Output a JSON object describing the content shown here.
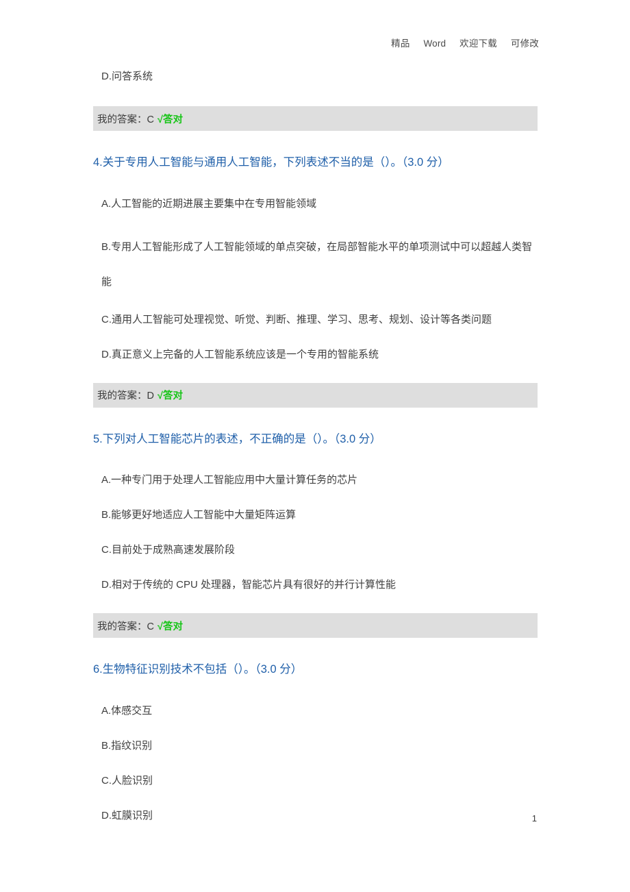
{
  "header": {
    "part1": "精品",
    "part2": "Word",
    "part3": "欢迎下载",
    "part4": "可修改"
  },
  "footer": {
    "page_number": "1"
  },
  "top_option": {
    "text": "D.问答系统"
  },
  "answers": {
    "answer_3": {
      "label": "我的答案：C",
      "mark": "√答对"
    },
    "answer_4": {
      "label": "我的答案：D",
      "mark": "√答对"
    },
    "answer_5": {
      "label": "我的答案：C",
      "mark": "√答对"
    }
  },
  "questions": [
    {
      "number": "4",
      "title": "4.关于专用人工智能与通用人工智能，下列表述不当的是（）。（3.0 分）",
      "options": [
        "A.人工智能的近期进展主要集中在专用智能领域",
        "B.专用人工智能形成了人工智能领域的单点突破，在局部智能水平的单项测试中可以超越人类智能",
        "C.通用人工智能可处理视觉、听觉、判断、推理、学习、思考、规划、设计等各类问题",
        "D.真正意义上完备的人工智能系统应该是一个专用的智能系统"
      ]
    },
    {
      "number": "5",
      "title": "5.下列对人工智能芯片的表述，不正确的是（）。（3.0 分）",
      "options": [
        "A.一种专门用于处理人工智能应用中大量计算任务的芯片",
        "B.能够更好地适应人工智能中大量矩阵运算",
        "C.目前处于成熟高速发展阶段",
        "D.相对于传统的 CPU 处理器，智能芯片具有很好的并行计算性能"
      ]
    },
    {
      "number": "6",
      "title": "6.生物特征识别技术不包括（）。（3.0 分）",
      "options": [
        "A.体感交互",
        "B.指纹识别",
        "C.人脸识别",
        "D.虹膜识别"
      ]
    }
  ],
  "colors": {
    "question_blue": "#1f5fa9",
    "correct_green": "#16c416",
    "answer_bar_bg": "#dedede",
    "body_text": "#3f3f3f"
  }
}
